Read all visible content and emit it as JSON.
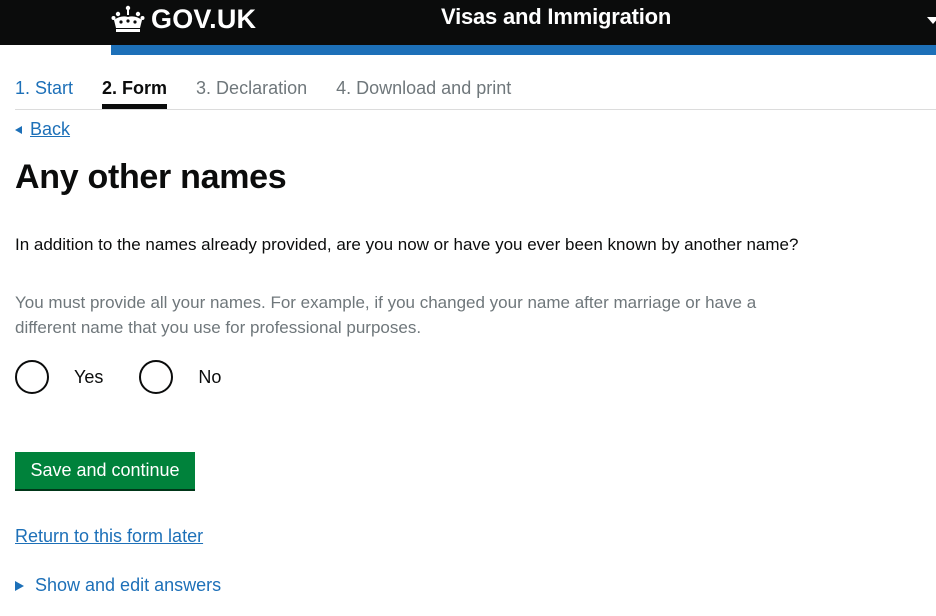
{
  "header": {
    "logo_text": "GOV.UK",
    "service_name": "Visas and Immigration",
    "icons": {
      "logo": "crown-icon",
      "menu": "caret-down-icon"
    }
  },
  "steps": [
    {
      "label": "1. Start",
      "state": "link"
    },
    {
      "label": "2. Form",
      "state": "active"
    },
    {
      "label": "3. Declaration",
      "state": "inactive"
    },
    {
      "label": "4. Download and print",
      "state": "inactive"
    }
  ],
  "back_link": "Back",
  "page_title": "Any other names",
  "question": "In addition to the names already provided, are you now or have you ever been known by another name?",
  "hint": "You must provide all your names. For example, if you changed your name after marriage or have a different name that you use for professional purposes.",
  "options": [
    {
      "label": "Yes",
      "selected": false
    },
    {
      "label": "No",
      "selected": false
    }
  ],
  "save_button": "Save and continue",
  "return_link": "Return to this form later",
  "details_summary": "Show and edit answers",
  "colors": {
    "header_bg": "#0b0c0c",
    "header_stripe": "#1d70b8",
    "link": "#1d70b8",
    "button": "#00823b",
    "hint_text": "#6f777b"
  }
}
